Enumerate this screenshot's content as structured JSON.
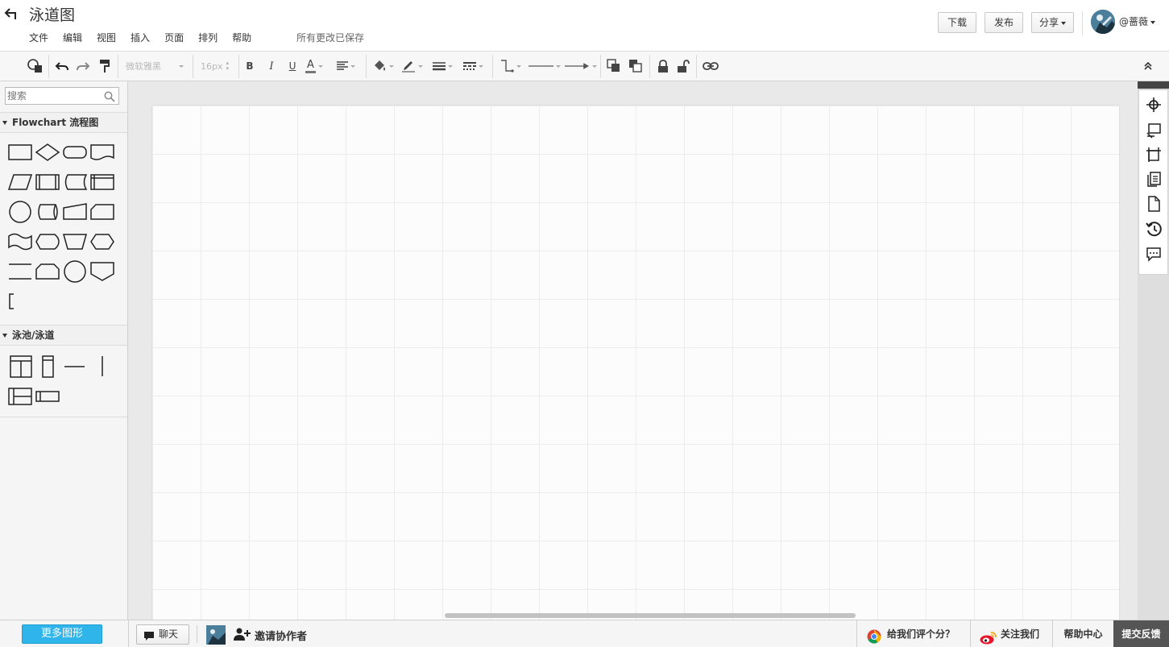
{
  "header": {
    "title": "泳道图",
    "menu": [
      "文件",
      "编辑",
      "视图",
      "插入",
      "页面",
      "排列",
      "帮助"
    ],
    "save_status": "所有更改已保存",
    "download_label": "下载",
    "publish_label": "发布",
    "share_label": "分享",
    "username": "@蔷薇"
  },
  "toolbar": {
    "font_family": "微软雅黑",
    "font_size": "16px",
    "bold": "B",
    "italic": "I",
    "underline": "U",
    "font_color": "A"
  },
  "sidebar": {
    "search_placeholder": "搜索",
    "categories": [
      {
        "label": "Flowchart 流程图"
      },
      {
        "label": "泳池/泳道"
      }
    ]
  },
  "footer": {
    "more_shapes": "更多图形",
    "chat": "聊天",
    "invite": "邀请协作者",
    "rate": "给我们评个分？",
    "follow": "关注我们",
    "help": "帮助中心",
    "feedback": "提交反馈"
  },
  "colors": {
    "accent": "#2fb5ea",
    "feedback_bg": "#555555",
    "weibo": "#e6162d"
  }
}
